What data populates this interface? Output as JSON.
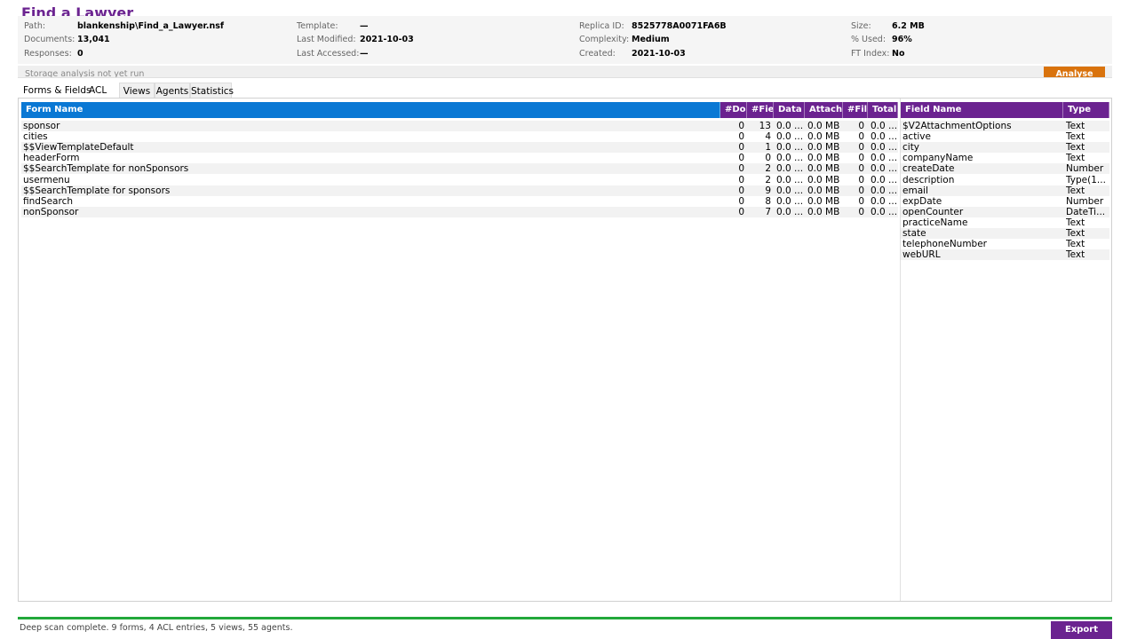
{
  "app": {
    "title": "Find a Lawyer"
  },
  "info": {
    "path_label": "Path:",
    "path": "blankenship\\Find_a_Lawyer.nsf",
    "documents_label": "Documents:",
    "documents": "13,041",
    "responses_label": "Responses:",
    "responses": "0",
    "template_label": "Template:",
    "template": "—",
    "last_modified_label": "Last Modified:",
    "last_modified": "2021-10-03",
    "last_accessed_label": "Last Accessed:",
    "last_accessed": "—",
    "replica_label": "Replica ID:",
    "replica": "8525778A0071FA6B",
    "complexity_label": "Complexity:",
    "complexity": "Medium",
    "created_label": "Created:",
    "created": "2021-10-03",
    "size_label": "Size:",
    "size": "6.2 MB",
    "used_label": "% Used:",
    "used": "96%",
    "ftindex_label": "FT Index:",
    "ftindex": "No"
  },
  "storage": {
    "text": "Storage analysis not yet run",
    "analyse_label": "Analyse"
  },
  "tabs": [
    "Forms & Fields",
    "ACL",
    "Views",
    "Agents",
    "Statistics"
  ],
  "forms_table": {
    "headers": [
      "Form Name",
      "#Doc",
      "#Fiel",
      "Data",
      "Attachi",
      "#File",
      "Total"
    ],
    "rows": [
      [
        "sponsor",
        "0",
        "13",
        "0.0 ...",
        "0.0 MB",
        "0",
        "0.0 ..."
      ],
      [
        "cities",
        "0",
        "4",
        "0.0 ...",
        "0.0 MB",
        "0",
        "0.0 ..."
      ],
      [
        "$$ViewTemplateDefault",
        "0",
        "1",
        "0.0 ...",
        "0.0 MB",
        "0",
        "0.0 ..."
      ],
      [
        "headerForm",
        "0",
        "0",
        "0.0 ...",
        "0.0 MB",
        "0",
        "0.0 ..."
      ],
      [
        "$$SearchTemplate for nonSponsors",
        "0",
        "2",
        "0.0 ...",
        "0.0 MB",
        "0",
        "0.0 ..."
      ],
      [
        "usermenu",
        "0",
        "2",
        "0.0 ...",
        "0.0 MB",
        "0",
        "0.0 ..."
      ],
      [
        "$$SearchTemplate for sponsors",
        "0",
        "9",
        "0.0 ...",
        "0.0 MB",
        "0",
        "0.0 ..."
      ],
      [
        "findSearch",
        "0",
        "8",
        "0.0 ...",
        "0.0 MB",
        "0",
        "0.0 ..."
      ],
      [
        "nonSponsor",
        "0",
        "7",
        "0.0 ...",
        "0.0 MB",
        "0",
        "0.0 ..."
      ]
    ]
  },
  "fields_table": {
    "headers": [
      "Field Name",
      "Type"
    ],
    "rows": [
      [
        "$V2AttachmentOptions",
        "Text"
      ],
      [
        "active",
        "Text"
      ],
      [
        "city",
        "Text"
      ],
      [
        "companyName",
        "Text"
      ],
      [
        "createDate",
        "Number"
      ],
      [
        "description",
        "Type(1..."
      ],
      [
        "email",
        "Text"
      ],
      [
        "expDate",
        "Number"
      ],
      [
        "openCounter",
        "DateTi..."
      ],
      [
        "practiceName",
        "Text"
      ],
      [
        "state",
        "Text"
      ],
      [
        "telephoneNumber",
        "Text"
      ],
      [
        "webURL",
        "Text"
      ]
    ]
  },
  "status": {
    "text": "Deep scan complete. 9 forms, 4 ACL entries, 5 views, 55 agents.",
    "export_label": "Export"
  },
  "colors": {
    "accent_purple": "#6b2390",
    "header_blue": "#0a78d4",
    "analyse_orange": "#d9730d",
    "status_green": "#22a83a"
  }
}
